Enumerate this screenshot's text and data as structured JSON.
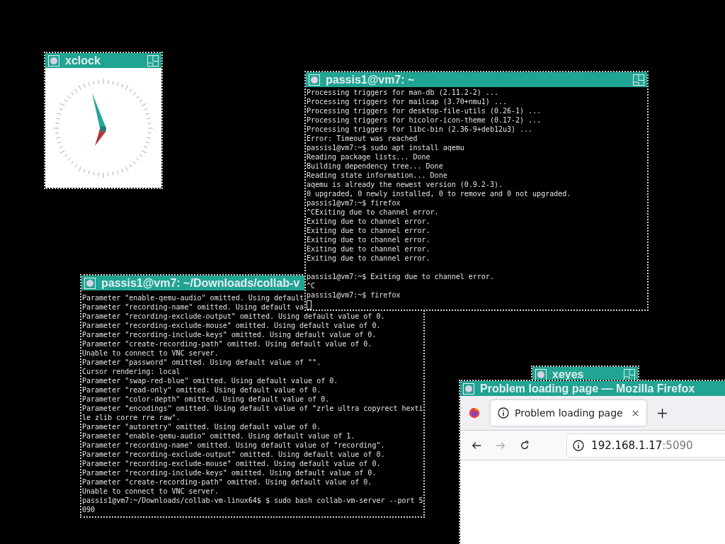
{
  "windows": [
    {
      "kind": "clock",
      "title": "xclock"
    },
    {
      "kind": "terminal",
      "title": "passis1@vm7: ~/Downloads/collab-v",
      "blocks": [
        [
          "Parameter \"enable-qemu-audio\" omitted. Using default",
          "Parameter \"recording-name\" omitted. Using default va",
          "Parameter \"recording-exclude-output\" omitted. Using default value of 0.",
          "Parameter \"recording-exclude-mouse\" omitted. Using default value of 0.",
          "Parameter \"recording-include-keys\" omitted. Using default value of 0.",
          "Parameter \"create-recording-path\" omitted. Using default value of 0.",
          "Unable to connect to VNC server.",
          "Parameter \"password\" omitted. Using default value of \"\".",
          "Cursor rendering: local",
          "Parameter \"swap-red-blue\" omitted. Using default value of 0.",
          "Parameter \"read-only\" omitted. Using default value of 0.",
          "Parameter \"color-depth\" omitted. Using default value of 0.",
          "Parameter \"encodings\" omitted. Using default value of \"zrle ultra copyrect hexti",
          "le zlib corre rre raw\".",
          "Parameter \"autoretry\" omitted. Using default value of 0.",
          "Parameter \"enable-qemu-audio\" omitted. Using default value of 1.",
          "Parameter \"recording-name\" omitted. Using default value of \"recording\".",
          "Parameter \"recording-exclude-output\" omitted. Using default value of 0.",
          "Parameter \"recording-exclude-mouse\" omitted. Using default value of 0.",
          "Parameter \"recording-include-keys\" omitted. Using default value of 0.",
          "Parameter \"create-recording-path\" omitted. Using default value of 0.",
          "Unable to connect to VNC server.",
          "passis1@vm7:~/Downloads/collab-vm-linux64$ $ sudo bash collab-vm-server --port 5",
          "090"
        ]
      ]
    },
    {
      "kind": "terminal",
      "title": "passis1@vm7: ~",
      "cursor": true,
      "blocks": [
        [
          "Processing triggers for man-db (2.11.2-2) ...",
          "Processing triggers for mailcap (3.70+nmu1) ...",
          "Processing triggers for desktop-file-utils (0.26-1) ...",
          "Processing triggers for hicolor-icon-theme (0.17-2) ...",
          "Processing triggers for libc-bin (2.36-9+deb12u3) ...",
          "Error: Timeout was reached",
          "passis1@vm7:~$ sudo apt install aqemu",
          "Reading package lists... Done",
          "Building dependency tree... Done",
          "Reading state information... Done",
          "aqemu is already the newest version (0.9.2-3).",
          "0 upgraded, 0 newly installed, 0 to remove and 0 not upgraded.",
          "passis1@vm7:~$ firefox",
          "^CExiting due to channel error.",
          "Exiting due to channel error.",
          "Exiting due to channel error.",
          "Exiting due to channel error.",
          "Exiting due to channel error.",
          "Exiting due to channel error."
        ],
        [
          "passis1@vm7:~$ Exiting due to channel error.",
          "^C",
          "passis1@vm7:~$ firefox"
        ]
      ]
    },
    {
      "kind": "blank",
      "title": "xeyes"
    },
    {
      "kind": "browser",
      "title": "Problem loading page — Mozilla Firefox",
      "tabs": [
        {
          "label": "Problem loading page",
          "selected": true
        }
      ],
      "url": {
        "host": "192.168.1.17",
        "port": ":5090"
      }
    }
  ]
}
